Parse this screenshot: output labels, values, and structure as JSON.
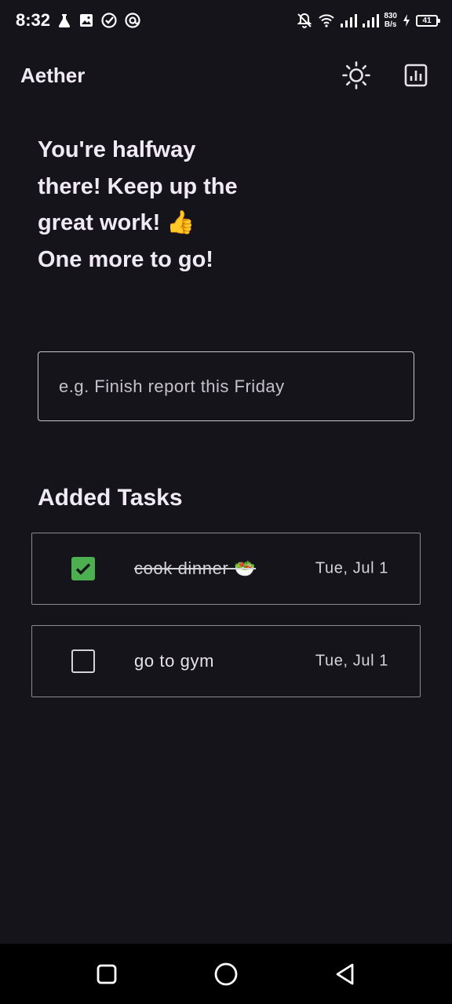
{
  "status_bar": {
    "time": "8:32",
    "net_speed_value": "830",
    "net_speed_unit": "B/s",
    "battery_level": "41"
  },
  "app": {
    "title": "Aether",
    "actions": [
      "sun-icon",
      "bar-chart-icon"
    ]
  },
  "message": {
    "lines": [
      "You're halfway",
      "there! Keep up the",
      "great work! 👍",
      "One more to go!"
    ]
  },
  "task_input": {
    "value": "",
    "placeholder": "e.g. Finish report this Friday"
  },
  "tasks_section": {
    "heading": "Added Tasks",
    "tasks": [
      {
        "name": "cook dinner 🥗",
        "date": "Tue, Jul 1",
        "done": true
      },
      {
        "name": "go to gym",
        "date": "Tue, Jul 1",
        "done": false
      }
    ]
  },
  "colors": {
    "background": "#16141b",
    "checkbox_checked": "#4caf50",
    "nav_bar": "#000000"
  },
  "nav_bar": {
    "buttons": [
      "recents-square-icon",
      "home-circle-icon",
      "back-triangle-icon"
    ]
  }
}
